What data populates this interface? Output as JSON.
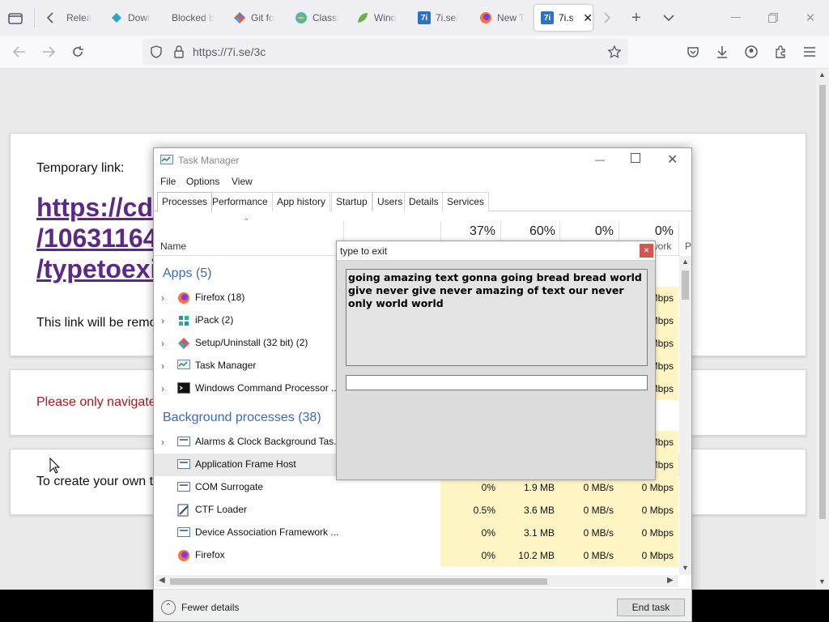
{
  "browser": {
    "tabs": [
      {
        "label": "Relea",
        "icon": "none"
      },
      {
        "label": "Dowr",
        "icon": "diamond-icon"
      },
      {
        "label": "Blocked b",
        "icon": "none"
      },
      {
        "label": "Git fo",
        "icon": "git-icon"
      },
      {
        "label": "Classi",
        "icon": "globe-icon"
      },
      {
        "label": "Wind",
        "icon": "leaf-icon"
      },
      {
        "label": "7i.se/",
        "icon": "7i-icon"
      },
      {
        "label": "New T",
        "icon": "firefox-icon"
      },
      {
        "label": "7i.s",
        "icon": "7i-icon",
        "active": true
      }
    ],
    "url": "https://7i.se/3c"
  },
  "page": {
    "temp_label": "Temporary link:",
    "link_text": "https://cd\n/10631164\n/typetoexi",
    "removed_text": "This link will be remo",
    "warning_text": "Please only navigate",
    "create_text": "To create your own t",
    "warning_color": "#a61b1b"
  },
  "task_manager": {
    "title": "Task Manager",
    "menu": [
      "File",
      "Options",
      "View"
    ],
    "tabs": [
      "Processes",
      "Performance",
      "App history",
      "Startup",
      "Users",
      "Details",
      "Services"
    ],
    "columns": {
      "name": "Name",
      "cpu_pct": "37%",
      "mem_pct": "60%",
      "disk_pct": "0%",
      "net_pct": "0%",
      "net_label": "work",
      "power_label": "P"
    },
    "apps_header": "Apps (5)",
    "apps": [
      {
        "name": "Firefox (18)",
        "icon": "firefox-icon",
        "net": "Mbps"
      },
      {
        "name": "iPack (2)",
        "icon": "ipack-icon",
        "net": "Mbps"
      },
      {
        "name": "Setup/Uninstall (32 bit) (2)",
        "icon": "setup-icon",
        "net": "Mbps"
      },
      {
        "name": "Task Manager",
        "icon": "taskmanager-icon",
        "net": "Mbps"
      },
      {
        "name": "Windows Command Processor ...",
        "icon": "cmd-icon",
        "net": "Mbps"
      }
    ],
    "bg_header": "Background processes (38)",
    "bg": [
      {
        "name": "Alarms & Clock Background Tas...",
        "icon": "app-icon",
        "expand": true,
        "cpu": "",
        "mem": "",
        "disk": "",
        "net": "Mbps"
      },
      {
        "name": "Application Frame Host",
        "icon": "app-icon",
        "expand": false,
        "cpu": "",
        "mem": "",
        "disk": "",
        "net": "Mbps",
        "selected": true
      },
      {
        "name": "COM Surrogate",
        "icon": "app-icon",
        "expand": false,
        "cpu": "0%",
        "mem": "1.9 MB",
        "disk": "0 MB/s",
        "net": "0 Mbps"
      },
      {
        "name": "CTF Loader",
        "icon": "ctf-icon",
        "expand": false,
        "cpu": "0.5%",
        "mem": "3.6 MB",
        "disk": "0 MB/s",
        "net": "0 Mbps"
      },
      {
        "name": "Device Association Framework ...",
        "icon": "app-icon",
        "expand": false,
        "cpu": "0%",
        "mem": "3.1 MB",
        "disk": "0 MB/s",
        "net": "0 Mbps"
      },
      {
        "name": "Firefox",
        "icon": "firefox-icon",
        "expand": false,
        "cpu": "0%",
        "mem": "10.2 MB",
        "disk": "0 MB/s",
        "net": "0 Mbps"
      }
    ],
    "fewer_details": "Fewer details",
    "end_task": "End task"
  },
  "dialog": {
    "title": "type to exit",
    "text": "going amazing text gonna going bread bread world give never give never amazing of text our never only world world",
    "input_value": ""
  }
}
